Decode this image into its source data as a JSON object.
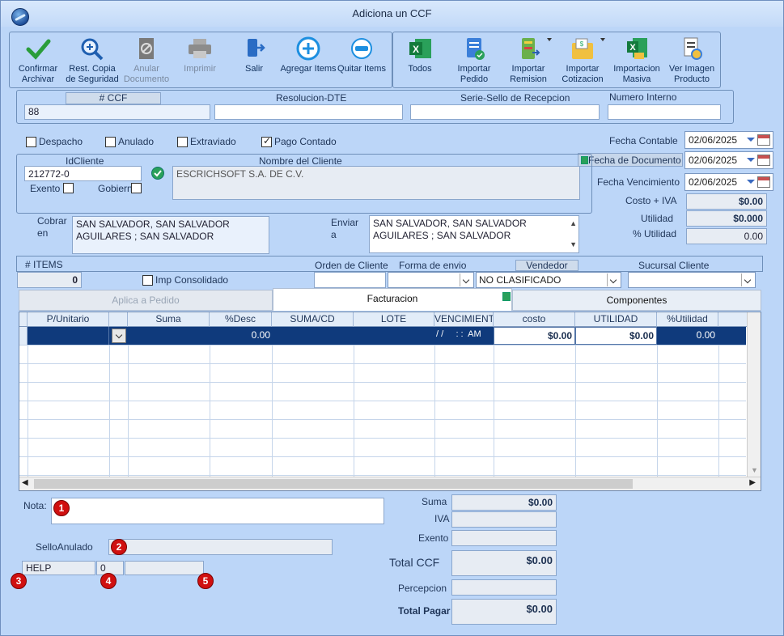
{
  "window": {
    "title": "Adiciona un CCF"
  },
  "toolbar": {
    "left": [
      {
        "label": "Confirmar Archivar",
        "icon": "checkmark-icon"
      },
      {
        "label": "Rest. Copia de Seguridad",
        "icon": "magnifier-plus-icon"
      },
      {
        "label": "Anular Documento",
        "icon": "void-document-icon"
      },
      {
        "label": "Imprimir",
        "icon": "printer-icon"
      },
      {
        "label": "Salir",
        "icon": "exit-door-icon"
      },
      {
        "label": "Agregar Items",
        "icon": "plus-circle-icon"
      },
      {
        "label": "Quitar Items",
        "icon": "minus-circle-icon"
      }
    ],
    "right": [
      {
        "label": "Todos",
        "icon": "excel-icon"
      },
      {
        "label": "Importar Pedido",
        "icon": "import-order-icon"
      },
      {
        "label": "Importar Remision",
        "icon": "import-remission-icon"
      },
      {
        "label": "Importar Cotizacion",
        "icon": "import-quote-icon"
      },
      {
        "label": "Importacion Masiva",
        "icon": "mass-import-excel-icon"
      },
      {
        "label": "Ver Imagen Producto",
        "icon": "view-product-image-icon"
      }
    ]
  },
  "header": {
    "ccf_label": "# CCF",
    "ccf_value": "88",
    "resolucion_label": "Resolucion-DTE",
    "resolucion_value": "",
    "serie_label": "Serie-Sello de Recepcion",
    "serie_value": "",
    "numero_interno_label": "Numero Interno",
    "numero_interno_value": ""
  },
  "checks": {
    "despacho": {
      "label": "Despacho",
      "checked": false
    },
    "anulado": {
      "label": "Anulado",
      "checked": false
    },
    "extraviado": {
      "label": "Extraviado",
      "checked": false
    },
    "pago_contado": {
      "label": "Pago Contado",
      "checked": true
    }
  },
  "dates": {
    "fecha_contable_label": "Fecha Contable",
    "fecha_contable": "02/06/2025",
    "fecha_documento_label": "Fecha de Documento",
    "fecha_documento": "02/06/2025",
    "fecha_vencimiento_label": "Fecha Vencimiento",
    "fecha_vencimiento": "02/06/2025"
  },
  "client": {
    "id_label": "IdCliente",
    "id_value": "212772-0",
    "name_label": "Nombre del Cliente",
    "name_value": "ESCRICHSOFT S.A. DE C.V.",
    "exento_label": "Exento",
    "gobierno_label": "Gobierno",
    "cobrar_label": "Cobrar en",
    "cobrar_line1": "SAN SALVADOR, SAN SALVADOR",
    "cobrar_line2": "AGUILARES ; SAN SALVADOR",
    "enviar_label": "Enviar a",
    "enviar_line1": "SAN SALVADOR, SAN SALVADOR",
    "enviar_line2": "AGUILARES ; SAN SALVADOR"
  },
  "summary_right": {
    "costo_iva_label": "Costo + IVA",
    "costo_iva": "$0.00",
    "utilidad_label": "Utilidad",
    "utilidad": "$0.000",
    "pct_utilidad_label": "% Utilidad",
    "pct_utilidad": "0.00"
  },
  "items_bar": {
    "items_label": "# ITEMS",
    "items_count": "0",
    "imp_consolidado_label": "Imp Consolidado",
    "orden_label": "Orden de Cliente",
    "orden_value": "",
    "forma_envio_label": "Forma de envio",
    "forma_envio_value": "",
    "vendedor_label": "Vendedor",
    "vendedor_value": "NO CLASIFICADO",
    "sucursal_label": "Sucursal Cliente",
    "sucursal_value": ""
  },
  "tabs": [
    {
      "label": "Aplica a Pedido",
      "active": false
    },
    {
      "label": "Facturacion",
      "active": true
    },
    {
      "label": "Componentes",
      "active": false
    }
  ],
  "grid": {
    "columns": [
      "P/Unitario",
      "",
      "Suma",
      "%Desc",
      "SUMA/CD",
      "LOTE",
      "VENCIMIENT",
      "costo",
      "UTILIDAD",
      "%Utilidad"
    ],
    "row": {
      "desc": "0.00",
      "venc": "/ /     : :  AM",
      "costo": "$0.00",
      "utilidad": "$0.00",
      "pct": "0.00"
    }
  },
  "footer": {
    "nota_label": "Nota:",
    "nota_value": "",
    "sello_label": "SelloAnulado",
    "sello_value": "",
    "help_text": "HELP",
    "help_count": "0",
    "help_extra": "",
    "badges": [
      "1",
      "2",
      "3",
      "4",
      "5"
    ],
    "suma_label": "Suma",
    "suma": "$0.00",
    "iva_label": "IVA",
    "iva": "",
    "exento_label": "Exento",
    "exento": "",
    "total_ccf_label": "Total CCF",
    "total_ccf": "$0.00",
    "percepcion_label": "Percepcion",
    "percepcion": "",
    "total_pagar_label": "Total Pagar",
    "total_pagar": "$0.00"
  }
}
